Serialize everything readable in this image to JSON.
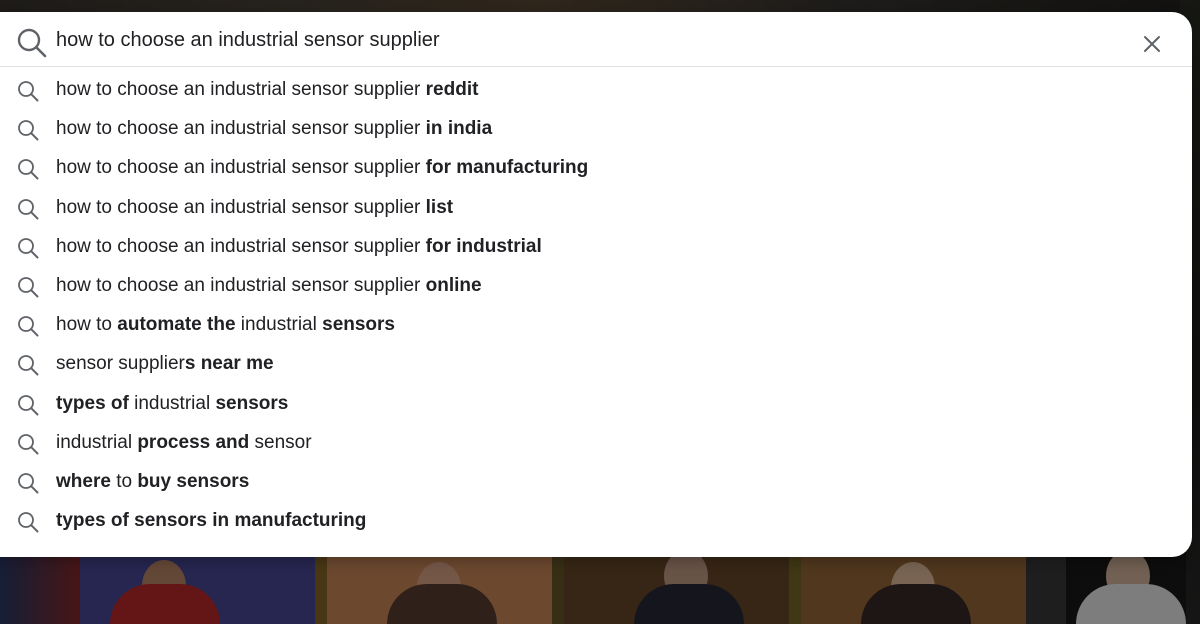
{
  "search": {
    "value": "how to choose an industrial sensor supplier",
    "search_icon": "search-icon",
    "clear_icon": "close-icon"
  },
  "suggestions": [
    {
      "icon": "search-icon",
      "parts": [
        {
          "text": "how to choose an industrial sensor supplier ",
          "bold": false
        },
        {
          "text": "reddit",
          "bold": true
        }
      ]
    },
    {
      "icon": "search-icon",
      "parts": [
        {
          "text": "how to choose an industrial sensor supplier ",
          "bold": false
        },
        {
          "text": "in india",
          "bold": true
        }
      ]
    },
    {
      "icon": "search-icon",
      "parts": [
        {
          "text": "how to choose an industrial sensor supplier ",
          "bold": false
        },
        {
          "text": "for manufacturing",
          "bold": true
        }
      ]
    },
    {
      "icon": "search-icon",
      "parts": [
        {
          "text": "how to choose an industrial sensor supplier ",
          "bold": false
        },
        {
          "text": "list",
          "bold": true
        }
      ]
    },
    {
      "icon": "search-icon",
      "parts": [
        {
          "text": "how to choose an industrial sensor supplier ",
          "bold": false
        },
        {
          "text": "for industrial",
          "bold": true
        }
      ]
    },
    {
      "icon": "search-icon",
      "parts": [
        {
          "text": "how to choose an industrial sensor supplier ",
          "bold": false
        },
        {
          "text": "online",
          "bold": true
        }
      ]
    },
    {
      "icon": "search-icon",
      "parts": [
        {
          "text": "how to ",
          "bold": false
        },
        {
          "text": "automate the",
          "bold": true
        },
        {
          "text": " industrial ",
          "bold": false
        },
        {
          "text": "sensors",
          "bold": true
        }
      ]
    },
    {
      "icon": "search-icon",
      "parts": [
        {
          "text": "sensor supplier",
          "bold": false
        },
        {
          "text": "s near me",
          "bold": true
        }
      ]
    },
    {
      "icon": "search-icon",
      "parts": [
        {
          "text": "types of",
          "bold": true
        },
        {
          "text": " industrial ",
          "bold": false
        },
        {
          "text": "sensors",
          "bold": true
        }
      ]
    },
    {
      "icon": "search-icon",
      "parts": [
        {
          "text": "industrial ",
          "bold": false
        },
        {
          "text": "process and",
          "bold": true
        },
        {
          "text": " sensor",
          "bold": false
        }
      ]
    },
    {
      "icon": "search-icon",
      "parts": [
        {
          "text": "where",
          "bold": true
        },
        {
          "text": " to ",
          "bold": false
        },
        {
          "text": "buy sensors",
          "bold": true
        }
      ]
    },
    {
      "icon": "search-icon",
      "parts": [
        {
          "text": "types of sensors in manufacturing",
          "bold": true
        }
      ]
    }
  ],
  "colors": {
    "panel_bg": "#ffffff",
    "text": "#202124",
    "icon": "#5f6368",
    "divider": "#e2e2e2"
  }
}
